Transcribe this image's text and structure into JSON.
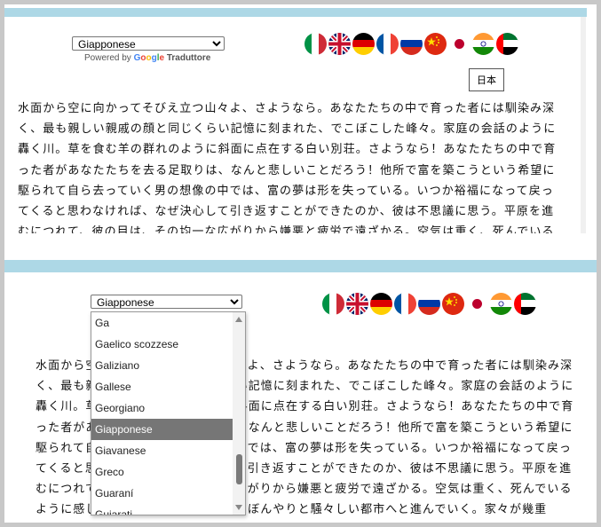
{
  "widget_top": {
    "selected_language": "Giapponese",
    "powered_by": "Powered by",
    "google": "Google",
    "translator": "Traduttore",
    "tooltip": "日本"
  },
  "widget_bottom": {
    "selected_language": "Giapponese"
  },
  "flags": [
    "flag-italy-icon",
    "flag-uk-icon",
    "flag-germany-icon",
    "flag-france-icon",
    "flag-russia-icon",
    "flag-china-icon",
    "flag-japan-icon",
    "flag-india-icon",
    "flag-uae-icon"
  ],
  "top_text": [
    "水面から空に向かってそびえ立つ山々よ、さようなら。あなたたちの中で育った者には馴染み深",
    "く、最も親しい親戚の顔と同じくらい記憶に刻まれた、でこぼこした峰々。家庭の会話のように",
    "轟く川。草を食む羊の群れのように斜面に点在する白い別荘。さようなら！あなたたちの中で育",
    "った者があなたたちを去る足取りは、なんと悲しいことだろう！他所で富を築こうという希望に",
    "駆られて自ら去っていく男の想像の中では、富の夢は形を失っている。いつか裕福になって戻っ",
    "てくると思わなければ、なぜ決心して引き返すことができたのか、彼は不思議に思う。平原を進",
    "むにつれて、彼の目は、その均一な広がりから嫌悪と疲労で遠ざかる。空気は重く、死んでいる"
  ],
  "bottom_text": [
    "水面から空に向かってそびえ立つ山々よ、さようなら。あなたたちの中で育った者には馴染み深",
    "く、最も親しい親戚の顔と同じくらい記憶に刻まれた、でこぼこした峰々。家庭の会話のように",
    "轟く川。草を食む羊の群れのように斜面に点在する白い別荘。さようなら！あなたたちの中で育",
    "った者があなたたちを去る足取りは、なんと悲しいことだろう！他所で富を築こうという希望に",
    "駆られて自ら去っていく男の想像の中では、富の夢は形を失っている。いつか裕福になって戻っ",
    "てくると思わなければ、なぜ決心して引き返すことができたのか、彼は不思議に思う。平原を進",
    "むにつれて、彼の目は、その均一な広がりから嫌悪と疲労で遠ざかる。空気は重く、死んでいる",
    "ように感じられ、彼は悲しげにそしてぼんやりと騒々しい都市へと進んでいく。家々が幾重"
  ],
  "dropdown_items": [
    "Ga",
    "Gaelico scozzese",
    "Galiziano",
    "Gallese",
    "Georgiano",
    "Giapponese",
    "Giavanese",
    "Greco",
    "Guaraní",
    "Gujarati"
  ],
  "dropdown_selected_index": 5
}
